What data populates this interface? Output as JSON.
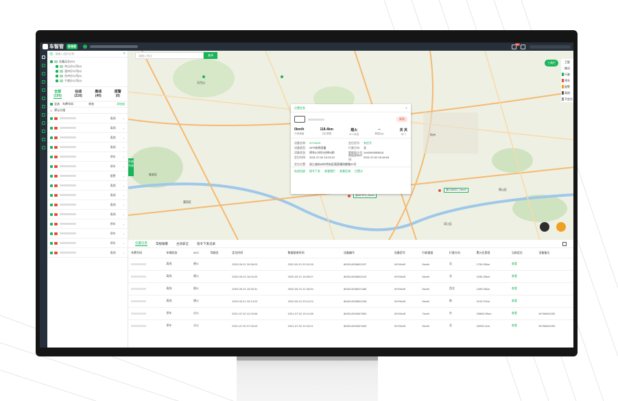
{
  "app": {
    "logo_text": "车智管",
    "edition_badge": "标准版",
    "notification_count": "99+"
  },
  "sidebar_panel": {
    "search_placeholder": "请输入组织名称",
    "tree": [
      {
        "label": "宏鑫运业(40)"
      },
      {
        "label": "舟山分公司(0)"
      },
      {
        "label": "温州分公司(0)"
      },
      {
        "label": "台州分公司(0)"
      },
      {
        "label": "宁波分公司(0)"
      }
    ],
    "status_tabs": [
      {
        "label": "全部",
        "count": "(156)"
      },
      {
        "label": "在线",
        "count": "(116)"
      },
      {
        "label": "离线",
        "count": "(40)"
      },
      {
        "label": "报警",
        "count": "(0)"
      }
    ],
    "list_header": {
      "select_all": "全选",
      "plate_col": "车牌号码",
      "status_col": "状态",
      "add_group": "添加组"
    },
    "group_label": "默认分组",
    "vehicles": [
      {
        "status": "离线"
      },
      {
        "status": "离线"
      },
      {
        "status": "离线"
      },
      {
        "status": "离线"
      },
      {
        "status": "停车"
      },
      {
        "status": "停车"
      },
      {
        "status": "报警"
      },
      {
        "status": "离线"
      },
      {
        "status": "离线"
      },
      {
        "status": "离线"
      },
      {
        "status": "离线"
      },
      {
        "status": "停车"
      },
      {
        "status": "停车"
      },
      {
        "status": "停车"
      },
      {
        "status": "离线"
      }
    ]
  },
  "map": {
    "search_placeholder": "请输入地点",
    "search_button": "查询",
    "tool_button": "工具栏",
    "side_tab": "车辆列表",
    "legend": [
      {
        "label": "卫星",
        "color": "#ffffff"
      },
      {
        "label": "路况",
        "color": "#ffffff"
      },
      {
        "label": "行驶",
        "color": "#19b35a"
      },
      {
        "label": "停车",
        "color": "#e74c3c"
      },
      {
        "label": "报警",
        "color": "#f39c12"
      },
      {
        "label": "离线",
        "color": "#555555"
      },
      {
        "label": "不定位",
        "color": "#999999"
      }
    ],
    "place_labels": [
      {
        "text": "天目山"
      },
      {
        "text": "杭州"
      },
      {
        "text": "临安区"
      },
      {
        "text": "富阳区"
      },
      {
        "text": "萧山区"
      },
      {
        "text": "滨江区"
      }
    ],
    "vehicle_plates": [
      "浙A67676 | 0km/h",
      "浙GJ66021 | 0km/h"
    ]
  },
  "popup": {
    "tab": "位置信息",
    "status_badge": "离线",
    "stats": [
      {
        "value": "0km/h",
        "label": "行驶速度"
      },
      {
        "value": "118.4km",
        "label": "当日里程"
      },
      {
        "value": "熄火",
        "label": "ACC状态"
      },
      {
        "value": "--",
        "label": "载重(kg)"
      },
      {
        "value": "关 关",
        "label": "车门"
      }
    ],
    "info": [
      {
        "k1": "设备名称:",
        "v1": "WYMiniS",
        "k2": "定位信号:",
        "v2": "有信号"
      },
      {
        "k1": "设备类型:",
        "v1": "GPS有线设备",
        "k2": "行驶方向:",
        "v2": "北"
      },
      {
        "k1": "设备状态:",
        "v1": "停车0小时0分钟53秒",
        "k2": "物联网卡号:",
        "v2": "1440093553818"
      },
      {
        "k1": "定位时间:",
        "v1": "2021-07-02 10:23:12",
        "k2": "数据更新时间:",
        "v2": "2021-07-02 15:18:04"
      }
    ],
    "location_label": "定位位置:",
    "location_value": "浙江省杭州市余杭区瓶窑镇凤都路20号",
    "actions": [
      "轨迹回放",
      "指令下发",
      "查看围栏",
      "查看区域",
      "位置点"
    ]
  },
  "bottom_panel": {
    "tabs": [
      "位置信息",
      "常规报警",
      "主动安全",
      "指令下发记录"
    ],
    "columns": [
      "车牌号码",
      "车辆状态",
      "ACC",
      "驾驶员",
      "定位时间",
      "数据接收时间",
      "设备编号",
      "设备型号",
      "行驶速度",
      "行驶方向",
      "累计总里程",
      "当前定位",
      "设备备注"
    ],
    "rows": [
      {
        "status": "离线",
        "acc": "熄火",
        "driver": "",
        "loc_time": "2020-09-21 20:08:23",
        "recv_time": "2020-09-21 20:10:28",
        "device_id": "863014535652157",
        "model": "WYMiniS",
        "speed": "0km/h",
        "dir": "北",
        "mileage": "1750.53km",
        "current": "查看",
        "remark": ""
      },
      {
        "status": "离线",
        "acc": "熄火",
        "driver": "",
        "loc_time": "2020-09-21 16:04:20",
        "recv_time": "2020-09-21 16:05:07",
        "device_id": "863014535652140",
        "model": "WYMiniS",
        "speed": "0km/h",
        "dir": "北",
        "mileage": "1536.35km",
        "current": "查看",
        "remark": ""
      },
      {
        "status": "离线",
        "acc": "熄火",
        "driver": "",
        "loc_time": "2020-09-21 15:30:31",
        "recv_time": "2020-09-21 21:26:54",
        "device_id": "863014535021466",
        "model": "WYMiniS",
        "speed": "0km/h",
        "dir": "西北",
        "mileage": "1495.05km",
        "current": "查看",
        "remark": ""
      },
      {
        "status": "离线",
        "acc": "熄火",
        "driver": "",
        "loc_time": "2020-09-21 23:14:23",
        "recv_time": "2020-09-21 23:14:24",
        "device_id": "863014535652158",
        "model": "WYMiniS",
        "speed": "0km/h",
        "dir": "南",
        "mileage": "2103.97km",
        "current": "查看",
        "remark": ""
      },
      {
        "status": "停车",
        "acc": "点火",
        "driver": "",
        "loc_time": "2021-07-02 12:03:06",
        "recv_time": "2021-07-02 15:14:38",
        "device_id": "863014534067800",
        "model": "WYMiniS",
        "speed": "7km/h",
        "dir": "东",
        "mileage": "29898.29km",
        "current": "查看",
        "remark": "WYMINIS/2B"
      },
      {
        "status": "停车",
        "acc": "点火",
        "driver": "",
        "loc_time": "2021-07-02 07:28:43",
        "recv_time": "2021-07-02 10:15:21",
        "device_id": "863014534067849",
        "model": "WYMiniS",
        "speed": "0km/h",
        "dir": "北",
        "mileage": "43005.1km",
        "current": "查看",
        "remark": "WYMINIS/2B"
      }
    ]
  }
}
